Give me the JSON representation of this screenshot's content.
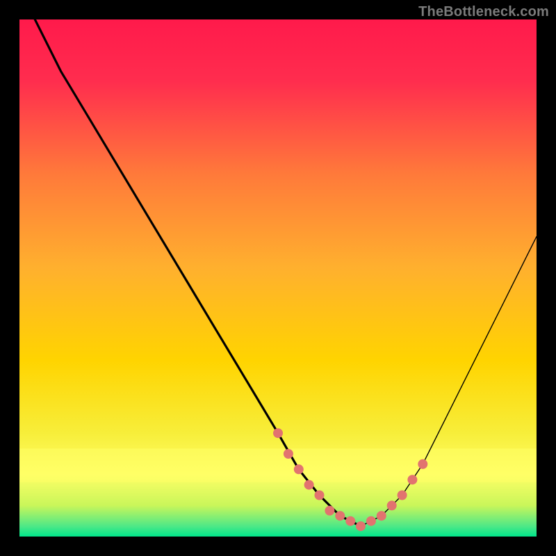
{
  "watermark": "TheBottleneck.com",
  "chart_data": {
    "type": "line",
    "title": "",
    "xlabel": "",
    "ylabel": "",
    "xlim": [
      0,
      100
    ],
    "ylim": [
      0,
      100
    ],
    "gradient_top_color": "#ff1a4b",
    "gradient_mid_color": "#ffd400",
    "gradient_bottom_band_color": "#ffff66",
    "gradient_base_color": "#00e58a",
    "curve_color": "#000000",
    "marker_color": "#e2736f",
    "series": [
      {
        "name": "bottleneck-curve",
        "x": [
          3,
          8,
          14,
          20,
          26,
          32,
          38,
          44,
          50,
          54,
          58,
          62,
          66,
          70,
          74,
          78,
          82,
          86,
          90,
          94,
          98,
          100
        ],
        "y": [
          100,
          90,
          80,
          70,
          60,
          50,
          40,
          30,
          20,
          13,
          8,
          4,
          2,
          4,
          8,
          14,
          22,
          30,
          38,
          46,
          54,
          58
        ]
      }
    ],
    "markers": {
      "name": "highlight-dots",
      "x": [
        50,
        52,
        54,
        56,
        58,
        60,
        62,
        64,
        66,
        68,
        70,
        72,
        74,
        76,
        78
      ],
      "y": [
        20,
        16,
        13,
        10,
        8,
        5,
        4,
        3,
        2,
        3,
        4,
        6,
        8,
        11,
        14
      ]
    }
  }
}
